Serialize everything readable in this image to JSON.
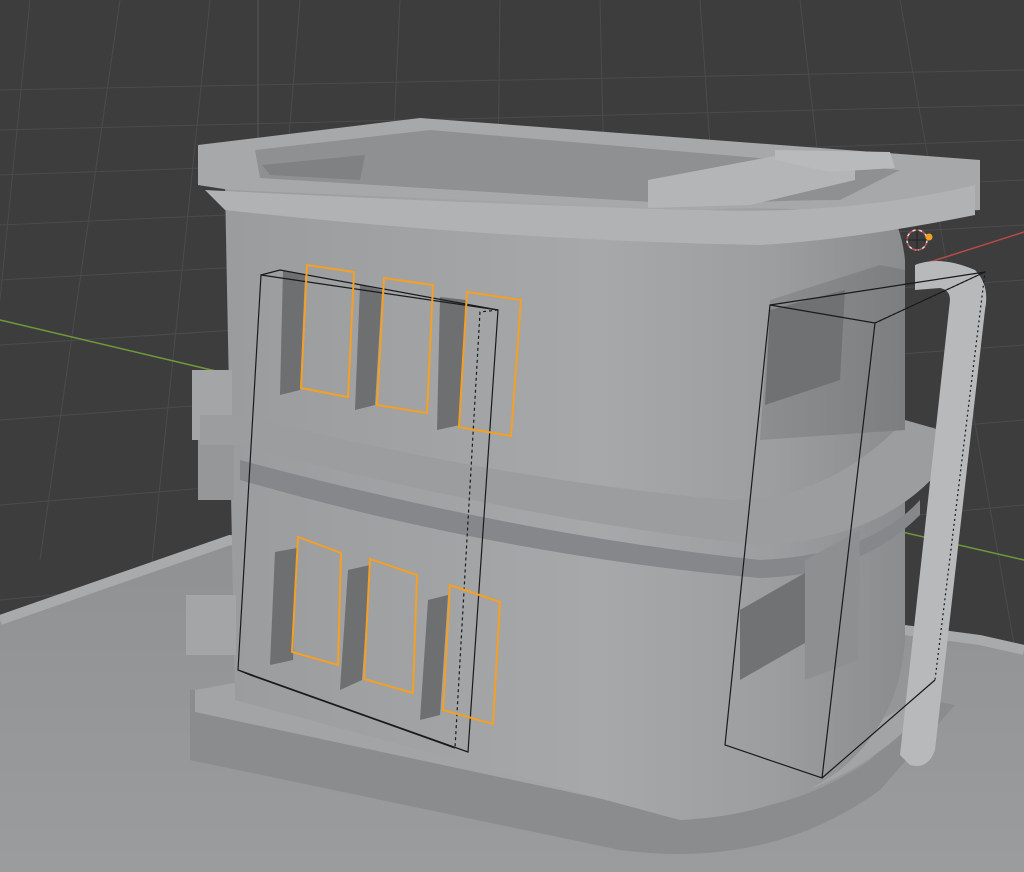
{
  "viewport": {
    "background_color": "#3d3d3d",
    "grid_color": "#4a4a4a",
    "x_axis_color": "#b84a4a",
    "y_axis_color": "#6f9a3a",
    "selection_color": "#f5a024",
    "cursor_icon": "3d-cursor-icon"
  },
  "scene": {
    "selected_objects": [
      "window-cutter-upper-1",
      "window-cutter-upper-2",
      "window-cutter-upper-3",
      "window-cutter-lower-1",
      "window-cutter-lower-2",
      "window-cutter-lower-3"
    ],
    "bounding_boxes": [
      "front-windows-bounds",
      "side-window-bounds"
    ]
  }
}
